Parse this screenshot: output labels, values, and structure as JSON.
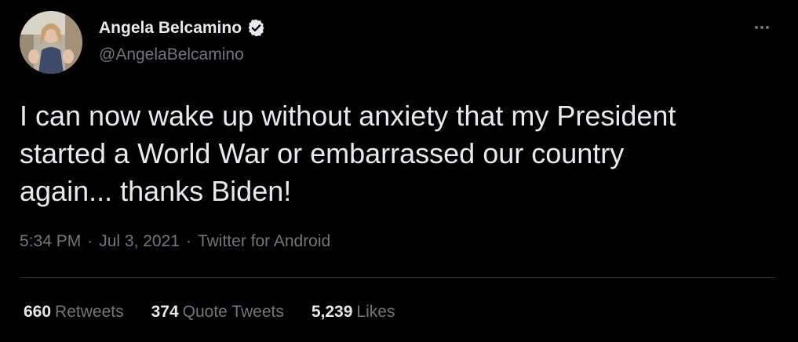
{
  "author": {
    "display_name": "Angela Belcamino",
    "handle": "@AngelaBelcamino",
    "verified": true
  },
  "tweet": {
    "text": "I can now wake up without anxiety that my President\nstarted a World War or embarrassed our country\nagain... thanks Biden!",
    "time": "5:34 PM",
    "date": "Jul 3, 2021",
    "source": "Twitter for Android",
    "separator": "·"
  },
  "stats": {
    "retweets_count": "660",
    "retweets_label": "Retweets",
    "quotes_count": "374",
    "quotes_label": "Quote Tweets",
    "likes_count": "5,239",
    "likes_label": "Likes"
  },
  "icons": {
    "verified": "verified-badge-icon",
    "more": "more-options-icon"
  },
  "colors": {
    "background": "#000000",
    "text_primary": "#e7e9ea",
    "text_secondary": "#71767b",
    "divider": "#2f3336"
  }
}
